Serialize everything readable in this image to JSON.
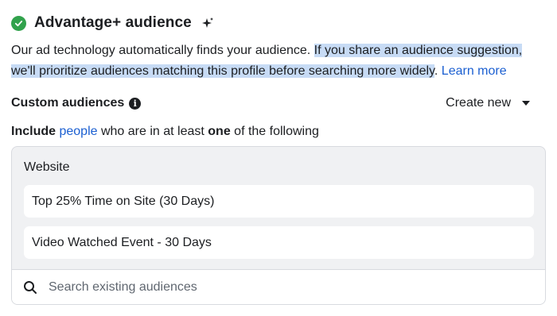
{
  "header": {
    "title": "Advantage+ audience",
    "status_icon": "check-circle-icon",
    "status_color": "#31a24c",
    "extra_icon": "sparkle-icon"
  },
  "description": {
    "part1": "Our ad technology automatically finds your audience. ",
    "highlighted": "If you share an audience suggestion, we'll prioritize audiences matching this profile before searching more widely",
    "part2": ". ",
    "learn_more": "Learn more"
  },
  "custom_audiences": {
    "label": "Custom audiences",
    "info_icon": "info-icon",
    "create_new": "Create new"
  },
  "include_line": {
    "include": "Include",
    "people": "people",
    "middle": " who are in at least ",
    "one": "one",
    "end": " of the following"
  },
  "panel": {
    "group_label": "Website",
    "items": [
      "Top 25% Time on Site (30 Days)",
      "Video Watched Event - 30 Days"
    ]
  },
  "search": {
    "placeholder": "Search existing audiences",
    "value": ""
  },
  "colors": {
    "link": "#1b5fd1",
    "highlight": "#c7dbf5",
    "panel_bg": "#f0f1f3"
  }
}
